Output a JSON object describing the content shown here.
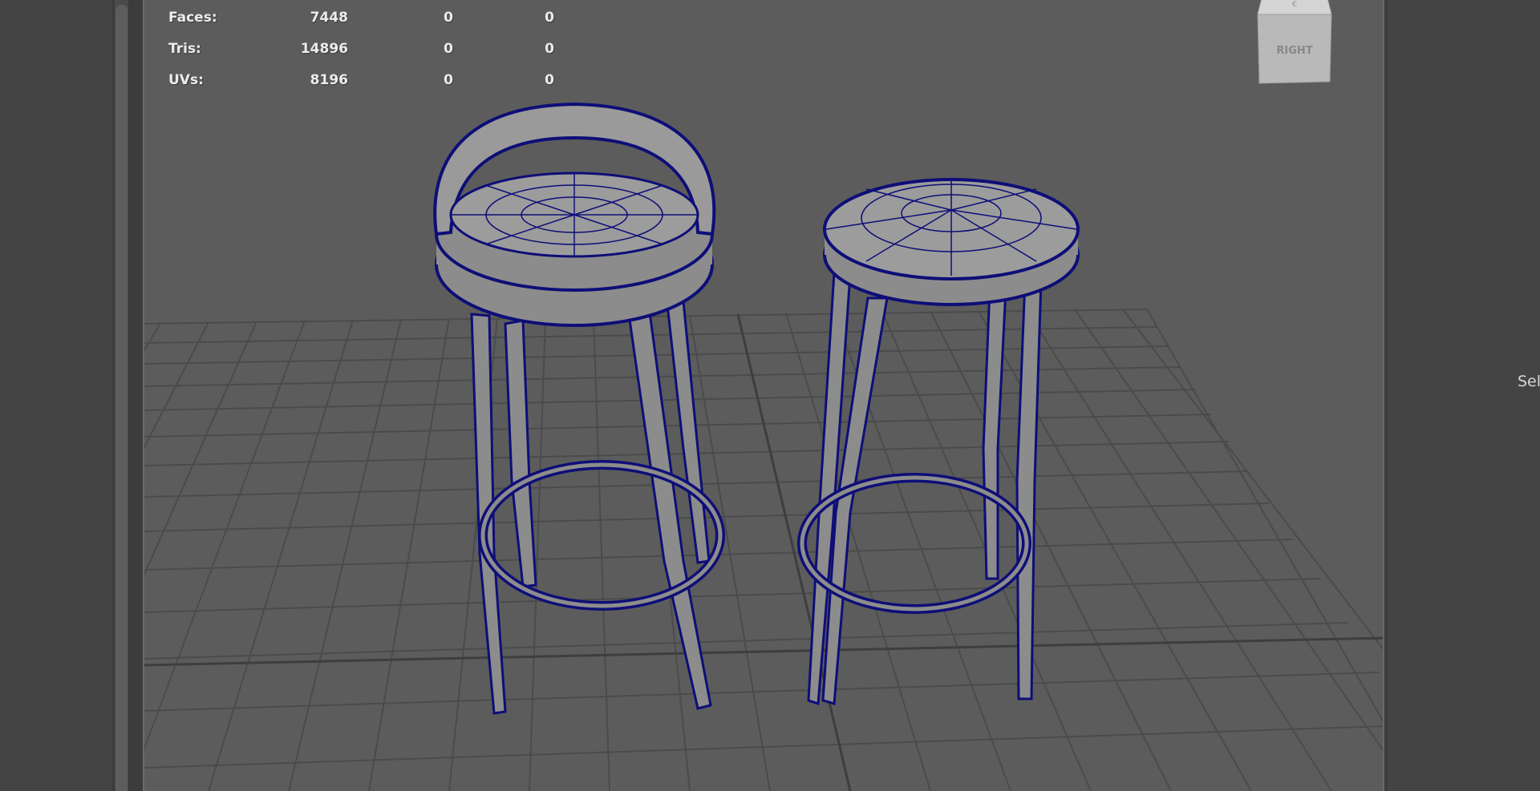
{
  "hud": {
    "rows": [
      {
        "label": "Faces:",
        "v1": "7448",
        "v2": "0",
        "v3": "0"
      },
      {
        "label": "Tris:",
        "v1": "14896",
        "v2": "0",
        "v3": "0"
      },
      {
        "label": "UVs:",
        "v1": "8196",
        "v2": "0",
        "v3": "0"
      }
    ]
  },
  "viewcube": {
    "face_label": "RIGHT"
  },
  "right_panel": {
    "label": "Sel"
  },
  "colors": {
    "viewport_bg": "#5c5c5c",
    "grid_line": "#4c4c4c",
    "wireframe": "#101080",
    "mesh_fill": "#8a8a8a",
    "panel_bg": "#444444"
  },
  "icons": [
    "viewcube-icon"
  ]
}
